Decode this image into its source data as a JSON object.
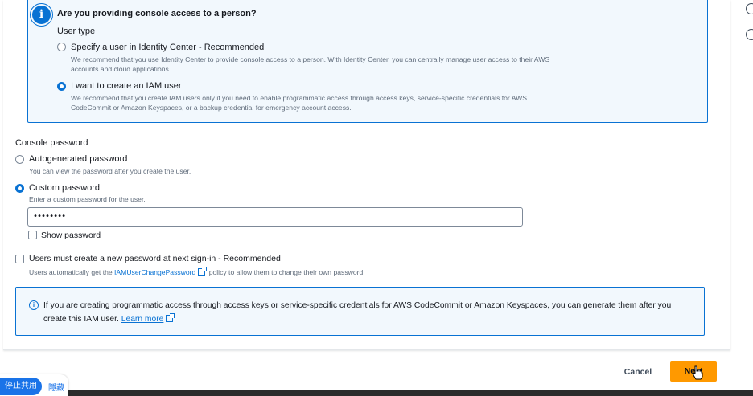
{
  "person_access": {
    "heading": "Are you providing console access to a person?",
    "user_type_label": "User type",
    "options": [
      {
        "title": "Specify a user in Identity Center - Recommended",
        "description": "We recommend that you use Identity Center to provide console access to a person. With Identity Center, you can centrally manage user access to their AWS accounts and cloud applications.",
        "selected": false
      },
      {
        "title": "I want to create an IAM user",
        "description": "We recommend that you create IAM users only if you need to enable programmatic access through access keys, service-specific credentials for AWS CodeCommit or Amazon Keyspaces, or a backup credential for emergency account access.",
        "selected": true
      }
    ]
  },
  "console_password": {
    "label": "Console password",
    "options": [
      {
        "title": "Autogenerated password",
        "description": "You can view the password after you create the user.",
        "selected": false
      },
      {
        "title": "Custom password",
        "description": "Enter a custom password for the user.",
        "selected": true
      }
    ],
    "password_value": "••••••••",
    "show_password_label": "Show password",
    "show_password_checked": false
  },
  "reset_password": {
    "label": "Users must create a new password at next sign-in - Recommended",
    "checked": false,
    "policy_prefix": "Users automatically get the ",
    "policy_link": "IAMUserChangePassword",
    "policy_suffix": " policy to allow them to change their own password."
  },
  "info_box": {
    "text": "If you are creating programmatic access through access keys or service-specific credentials for AWS CodeCommit or Amazon Keyspaces, you can generate them after you create this IAM user.",
    "link": "Learn more"
  },
  "footer": {
    "cancel_label": "Cancel",
    "next_label": "Next"
  },
  "screen_share": {
    "stop_label": "停止共用",
    "hide_label": "隱藏"
  },
  "colors": {
    "accent": "#0972d3",
    "primary_button": "#ff9900",
    "info_bg": "#f2f8fd"
  }
}
